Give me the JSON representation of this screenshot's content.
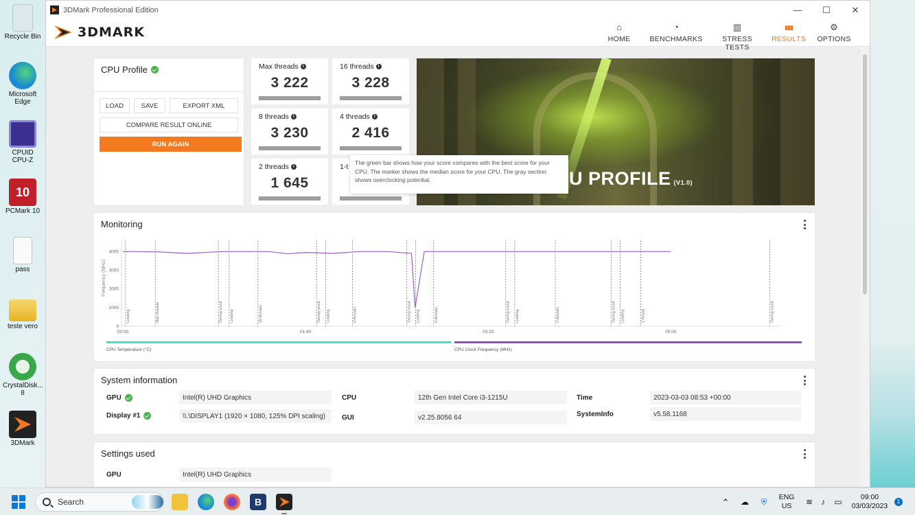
{
  "desktop": {
    "icons": [
      {
        "label": "Recycle Bin",
        "icon": "recycle-bin-icon",
        "color": "#d8e4ec"
      },
      {
        "label": "Microsoft Edge",
        "icon": "edge-icon",
        "color": "#1fa0d6"
      },
      {
        "label": "CPUID CPU-Z",
        "icon": "cpu-z-icon",
        "color": "#3b2f8f"
      },
      {
        "label": "PCMark 10",
        "icon": "pcmark-icon",
        "color": "#c0202a"
      },
      {
        "label": "pass",
        "icon": "text-file-icon",
        "color": "#f4f4f4"
      },
      {
        "label": "teste vero",
        "icon": "folder-icon",
        "color": "#f1c40f"
      },
      {
        "label": "CrystalDisk... 8",
        "icon": "crystaldisk-icon",
        "color": "#3aa84a"
      },
      {
        "label": "3DMark",
        "icon": "3dmark-icon",
        "color": "#222222"
      }
    ]
  },
  "window": {
    "title": "3DMark Professional Edition",
    "controls": {
      "minimize": "—",
      "maximize": "☐",
      "close": "✕"
    }
  },
  "app": {
    "logo_text": "3DMARK",
    "accent": "#f47a20",
    "nav": [
      {
        "label": "HOME",
        "icon": "home-icon",
        "glyph": "⌂"
      },
      {
        "label": "BENCHMARKS",
        "icon": "speedometer-icon",
        "glyph": "◔"
      },
      {
        "label": "STRESS TESTS",
        "icon": "bar-chart-icon",
        "glyph": "▥"
      },
      {
        "label": "RESULTS",
        "icon": "results-icon",
        "glyph": "▮▮▮",
        "active": true
      },
      {
        "label": "OPTIONS",
        "icon": "gear-icon",
        "glyph": "⚙"
      }
    ]
  },
  "profile": {
    "title": "CPU Profile",
    "load": "LOAD",
    "save": "SAVE",
    "export": "EXPORT XML",
    "compare": "COMPARE RESULT ONLINE",
    "run_again": "RUN AGAIN"
  },
  "scores": [
    {
      "label": "Max threads",
      "value": "3 222"
    },
    {
      "label": "16 threads",
      "value": "3 228"
    },
    {
      "label": "8 threads",
      "value": "3 230"
    },
    {
      "label": "4 threads",
      "value": "2 416"
    },
    {
      "label": "2 threads",
      "value": "1 645"
    },
    {
      "label": "1-t",
      "value": ""
    }
  ],
  "hero": {
    "title": "U PROFILE",
    "version": "(V1.0)"
  },
  "tooltip": {
    "text": "The green bar shows how your score compares with the best score for your CPU. The marker shows the median score for your CPU. The gray section shows overclocking potential."
  },
  "monitoring": {
    "title": "Monitoring",
    "y_label": "Frequency (MHz)",
    "y_ticks": [
      "4000",
      "3000",
      "2000",
      "1000",
      "0"
    ],
    "x_ticks": [
      "00:00",
      "01:40",
      "03:20",
      "05:00"
    ],
    "legend": [
      {
        "label": "CPU Temperature (°C)",
        "color": "#3ee0c8"
      },
      {
        "label": "CPU Clock Frequency (MHz)",
        "color": "#8e4fc0"
      }
    ],
    "markers": [
      "Loading",
      "Max threads",
      "Saving result",
      "Loading",
      "16 threads",
      "Saving result",
      "Loading",
      "8 threads",
      "Saving result",
      "Loading",
      "4 threads",
      "Saving result",
      "Loading",
      "2 threads",
      "Saving result",
      "Loading",
      "1 thread",
      "Saving result"
    ]
  },
  "chart_data": {
    "type": "line",
    "title": "",
    "xlabel": "",
    "ylabel": "Frequency (MHz)",
    "ylim": [
      0,
      4600
    ],
    "series": [
      {
        "name": "CPU Clock Frequency (MHz)",
        "x": [
          "00:00",
          "00:05",
          "00:20",
          "00:35",
          "00:55",
          "01:20",
          "01:30",
          "01:40",
          "01:55",
          "02:10",
          "02:25",
          "02:38",
          "02:40",
          "02:45",
          "02:55",
          "03:10",
          "03:40",
          "03:58",
          "04:10",
          "04:40",
          "04:50",
          "05:00"
        ],
        "values": [
          4000,
          4000,
          3980,
          3900,
          4000,
          4000,
          3880,
          3950,
          3900,
          4000,
          4000,
          3900,
          1000,
          4000,
          4000,
          4000,
          4000,
          4000,
          4000,
          4000,
          4000,
          4000
        ]
      }
    ]
  },
  "sysinfo": {
    "title": "System information",
    "gpu_key": "GPU",
    "gpu_val": "Intel(R) UHD Graphics",
    "display_key": "Display #1",
    "display_val": "\\\\.\\DISPLAY1 (1920 × 1080, 125% DPI scaling)",
    "cpu_key": "CPU",
    "cpu_val": "12th Gen Intel Core i3-1215U",
    "gui_key": "GUI",
    "gui_val": "v2.25.8056 64",
    "time_key": "Time",
    "time_val": "2023-03-03 08:53 +00:00",
    "sysinfo_key": "SystemInfo",
    "sysinfo_val": "v5.58.1168"
  },
  "settings": {
    "title": "Settings used",
    "gpu_key": "GPU",
    "gpu_val": "Intel(R) UHD Graphics"
  },
  "taskbar": {
    "search": "Search",
    "lang1": "ENG",
    "lang2": "US",
    "time": "09:00",
    "date": "03/03/2023",
    "notifications": "1"
  }
}
